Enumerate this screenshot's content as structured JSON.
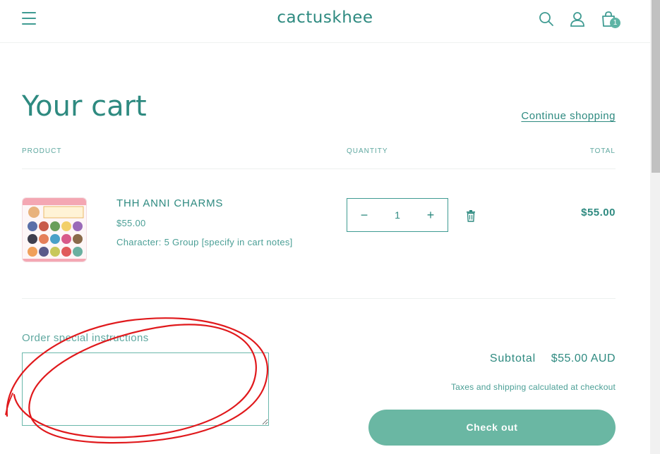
{
  "header": {
    "logo": "cactuskhee",
    "cart_count": "1",
    "icons": [
      "menu-icon",
      "search-icon",
      "account-icon",
      "cart-icon"
    ]
  },
  "page": {
    "title": "Your cart",
    "continue_label": "Continue shopping"
  },
  "table": {
    "columns": [
      "PRODUCT",
      "QUANTITY",
      "TOTAL"
    ]
  },
  "items": [
    {
      "title": "THH ANNI CHARMS",
      "price": "$55.00",
      "variant": "Character: 5 Group [specify in cart notes]",
      "quantity": "1",
      "decrement": "−",
      "increment": "+",
      "total": "$55.00"
    }
  ],
  "notes": {
    "label": "Order special instructions",
    "value": ""
  },
  "summary": {
    "subtotal_label": "Subtotal",
    "subtotal_value": "$55.00 AUD",
    "tax_note": "Taxes and shipping calculated at checkout",
    "checkout_label": "Check out"
  },
  "colors": {
    "brand": "#2e8a80",
    "button": "#6ab7a3",
    "annotation": "#e0191c"
  }
}
